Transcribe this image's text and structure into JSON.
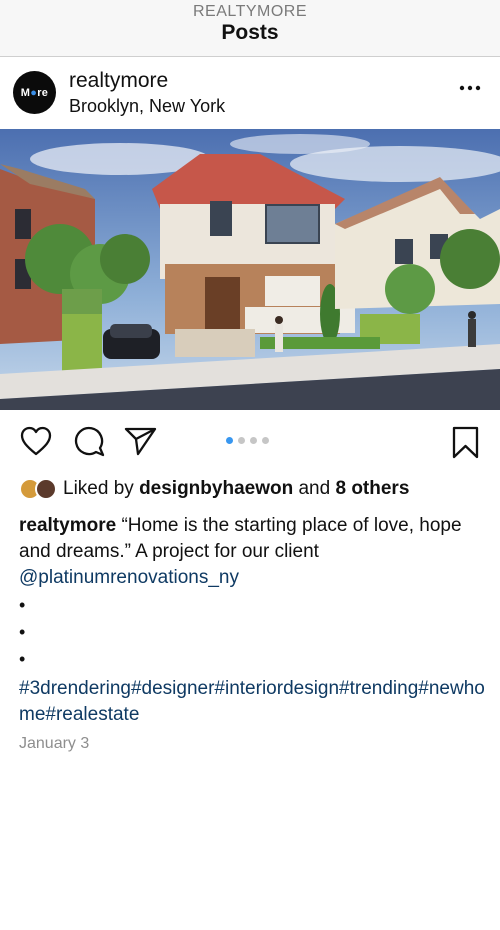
{
  "topbar": {
    "account": "REALTYMORE",
    "title": "Posts"
  },
  "post": {
    "avatar_text_a": "M",
    "avatar_text_b": "re",
    "avatar_logo_accent": "#3a8ee6",
    "username": "realtymore",
    "location": "Brooklyn, New York",
    "more_icon": "more-horizontal-icon",
    "image_description_icon": "photo",
    "carousel": {
      "count": 4,
      "active_index": 0,
      "active_color": "#3897f0"
    },
    "actions": {
      "like_icon": "heart-icon",
      "comment_icon": "comment-icon",
      "share_icon": "send-icon",
      "save_icon": "bookmark-icon"
    },
    "likes": {
      "prefix": "Liked by",
      "user": "designbyhaewon",
      "middle": "and",
      "others": "8 others"
    },
    "caption": {
      "user": "realtymore",
      "text": "“Home is the starting place of love, hope and dreams.” A project for our client",
      "mention": "@platinumrenovations_ny"
    },
    "bullets": [
      "•",
      "•",
      "•"
    ],
    "hashtags": "#3drendering#designer#interiordesign#trending#newhome#realestate",
    "date": "January 3"
  }
}
